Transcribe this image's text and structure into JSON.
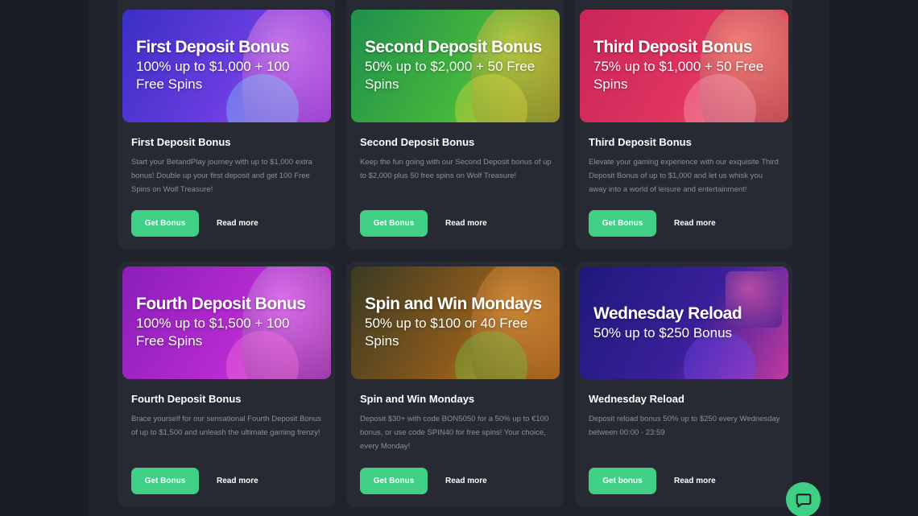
{
  "cards": [
    {
      "banner_title": "First Deposit Bonus",
      "banner_sub": "100% up to $1,000 + 100 Free Spins",
      "title": "First Deposit Bonus",
      "desc": "Start your BetandPlay journey with up to $1,000 extra bonus! Double up your first deposit and get 100 Free Spins on Wolf Treasure!",
      "cta": "Get Bonus",
      "link": "Read more",
      "gradient": [
        "#3a2fc4",
        "#6a3de0",
        "#c24de8"
      ]
    },
    {
      "banner_title": "Second Deposit Bonus",
      "banner_sub": "50% up to $2,000 + 50 Free Spins",
      "title": "Second Deposit Bonus",
      "desc": "Keep the fun going with our Second Deposit bonus of up to $2,000 plus 50 free spins on Wolf Treasure!",
      "cta": "Get Bonus",
      "link": "Read more",
      "gradient": [
        "#1f8f4e",
        "#47b83a",
        "#e0a224"
      ]
    },
    {
      "banner_title": "Third Deposit Bonus",
      "banner_sub": "75% up to $1,000 + 50 Free Spins",
      "title": "Third Deposit Bonus",
      "desc": "Elevate your gaming experience with our exquisite Third Deposit Bonus of up to $1,000 and let us whisk you away into a world of leisure and entertainment!",
      "cta": "Get Bonus",
      "link": "Read more",
      "gradient": [
        "#c8265a",
        "#e0345e",
        "#f06a58"
      ]
    },
    {
      "banner_title": "Fourth Deposit Bonus",
      "banner_sub": "100% up to $1,500 + 100 Free Spins",
      "title": "Fourth Deposit Bonus",
      "desc": "Brace yourself for our sensational Fourth Deposit Bonus of up to $1,500 and unleash the ultimate gaming frenzy!",
      "cta": "Get Bonus",
      "link": "Read more",
      "gradient": [
        "#8a1fb8",
        "#b52ad0",
        "#e04bd6"
      ]
    },
    {
      "banner_title": "Spin and Win Mondays",
      "banner_sub": "50% up to $100 or 40 Free Spins",
      "title": "Spin and Win Mondays",
      "desc": "Deposit $30+ with code BON5050 for a 50% up to €100 bonus, or use code SPIN40 for free spins! Your choice, every Monday!",
      "cta": "Get Bonus",
      "link": "Read more",
      "gradient": [
        "#3b3a22",
        "#8a5a1c",
        "#e08a22"
      ]
    },
    {
      "banner_title": "Wednesday Reload",
      "banner_sub": "50% up to $250 Bonus",
      "title": "Wednesday Reload",
      "desc": "Deposit reload bonus 50% up to $250 every Wednesday between 00:00 - 23:59",
      "cta": "Get bonus",
      "link": "Read more",
      "gradient": [
        "#1e1a7a",
        "#3a1f9a",
        "#c23aa0"
      ]
    }
  ],
  "chat_icon": "chat-bubble-icon"
}
